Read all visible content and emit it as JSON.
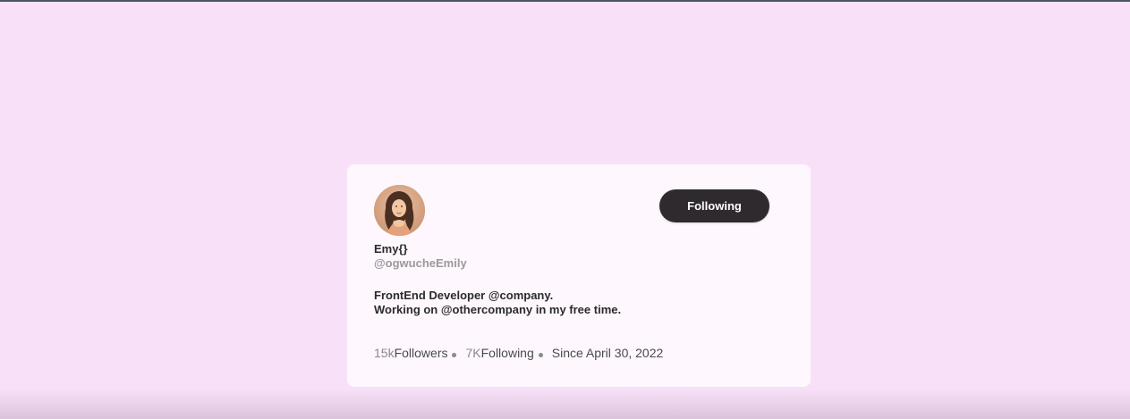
{
  "profile": {
    "name": "Emy{}",
    "handle": "@ogwucheEmily",
    "follow_button_label": "Following",
    "bio": [
      "FrontEnd Developer @company.",
      "Working on @othercompany in my free time."
    ],
    "stats": {
      "followers_count": "15k",
      "followers_label": "Followers",
      "following_count": "7K",
      "following_label": "Following",
      "since": "Since April 30, 2022"
    },
    "avatar_icon": "avatar-photo"
  },
  "colors": {
    "background": "#f8e1f8",
    "card": "#fef7fe",
    "button": "#2f2a2d",
    "button_text": "#ffffff",
    "muted_text": "#9a9a9a"
  }
}
